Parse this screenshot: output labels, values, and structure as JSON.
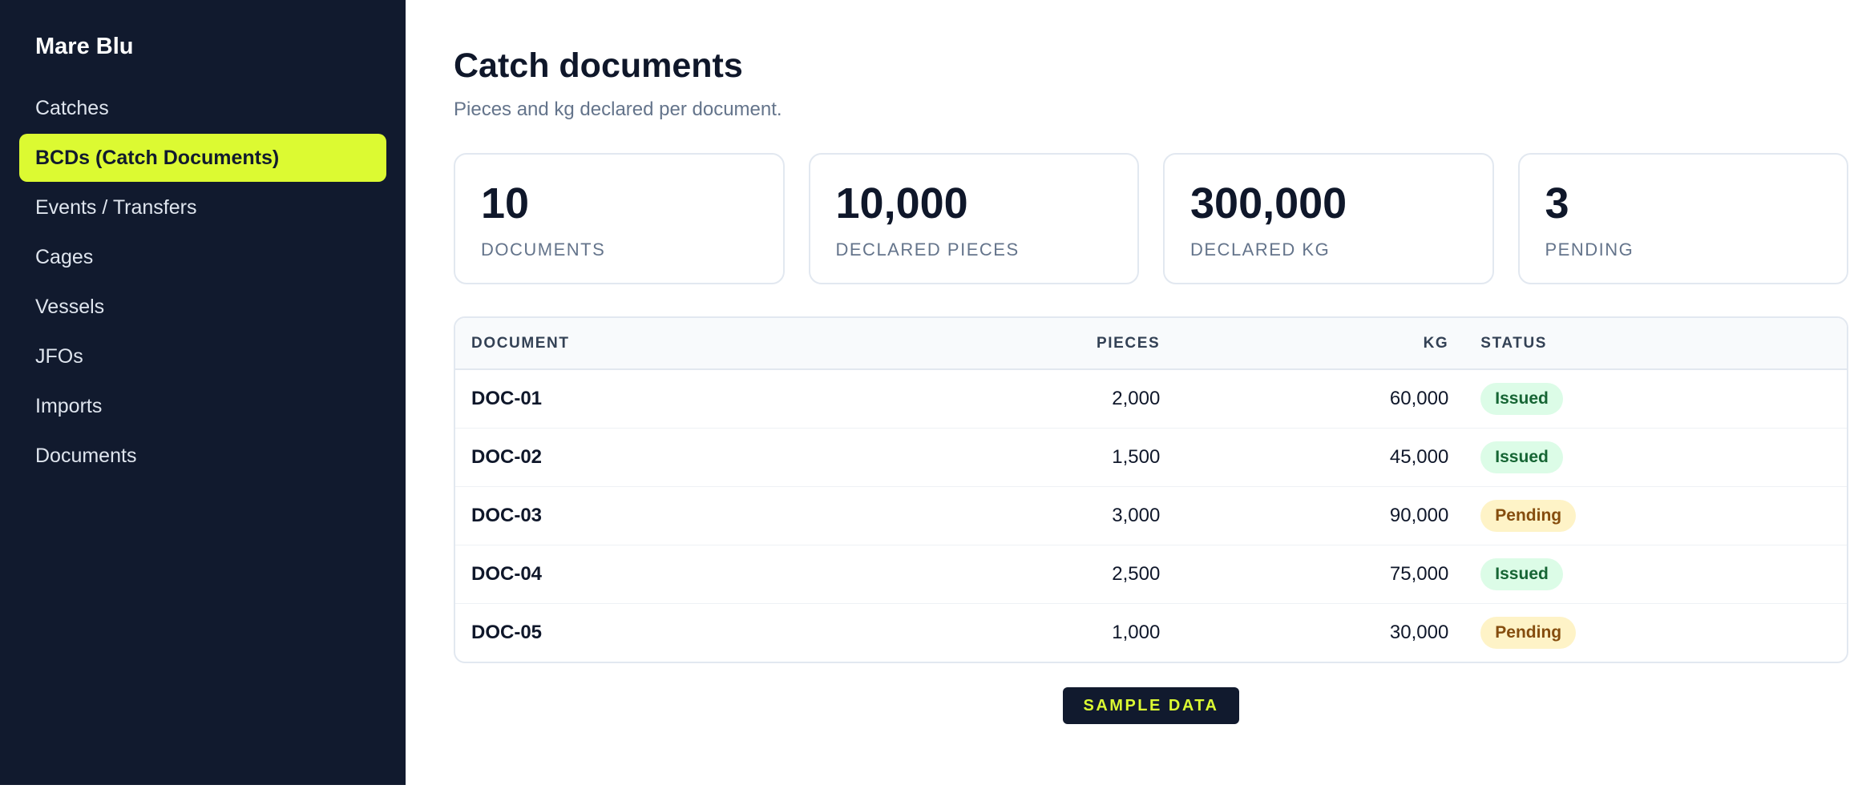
{
  "sidebar": {
    "brand": "Mare Blu",
    "items": [
      {
        "label": "Catches"
      },
      {
        "label": "BCDs (Catch Documents)",
        "active": true
      },
      {
        "label": "Events / Transfers"
      },
      {
        "label": "Cages"
      },
      {
        "label": "Vessels"
      },
      {
        "label": "JFOs"
      },
      {
        "label": "Imports"
      },
      {
        "label": "Documents"
      }
    ]
  },
  "header": {
    "title": "Catch documents",
    "subtitle": "Pieces and kg declared per document."
  },
  "stats": [
    {
      "value": "10",
      "label": "DOCUMENTS"
    },
    {
      "value": "10,000",
      "label": "DECLARED PIECES"
    },
    {
      "value": "300,000",
      "label": "DECLARED KG"
    },
    {
      "value": "3",
      "label": "PENDING"
    }
  ],
  "table": {
    "columns": [
      "DOCUMENT",
      "PIECES",
      "KG",
      "STATUS"
    ],
    "rows": [
      {
        "document": "DOC-01",
        "pieces": "2,000",
        "kg": "60,000",
        "status": "Issued"
      },
      {
        "document": "DOC-02",
        "pieces": "1,500",
        "kg": "45,000",
        "status": "Issued"
      },
      {
        "document": "DOC-03",
        "pieces": "3,000",
        "kg": "90,000",
        "status": "Pending"
      },
      {
        "document": "DOC-04",
        "pieces": "2,500",
        "kg": "75,000",
        "status": "Issued"
      },
      {
        "document": "DOC-05",
        "pieces": "1,000",
        "kg": "30,000",
        "status": "Pending"
      }
    ]
  },
  "footer": {
    "sample_label": "SAMPLE DATA"
  },
  "colors": {
    "sidebar_bg": "#111a2e",
    "accent": "#dcfa32",
    "issued_bg": "#dcfce7",
    "issued_text": "#166534",
    "pending_bg": "#fef3c7",
    "pending_text": "#854d0e"
  }
}
